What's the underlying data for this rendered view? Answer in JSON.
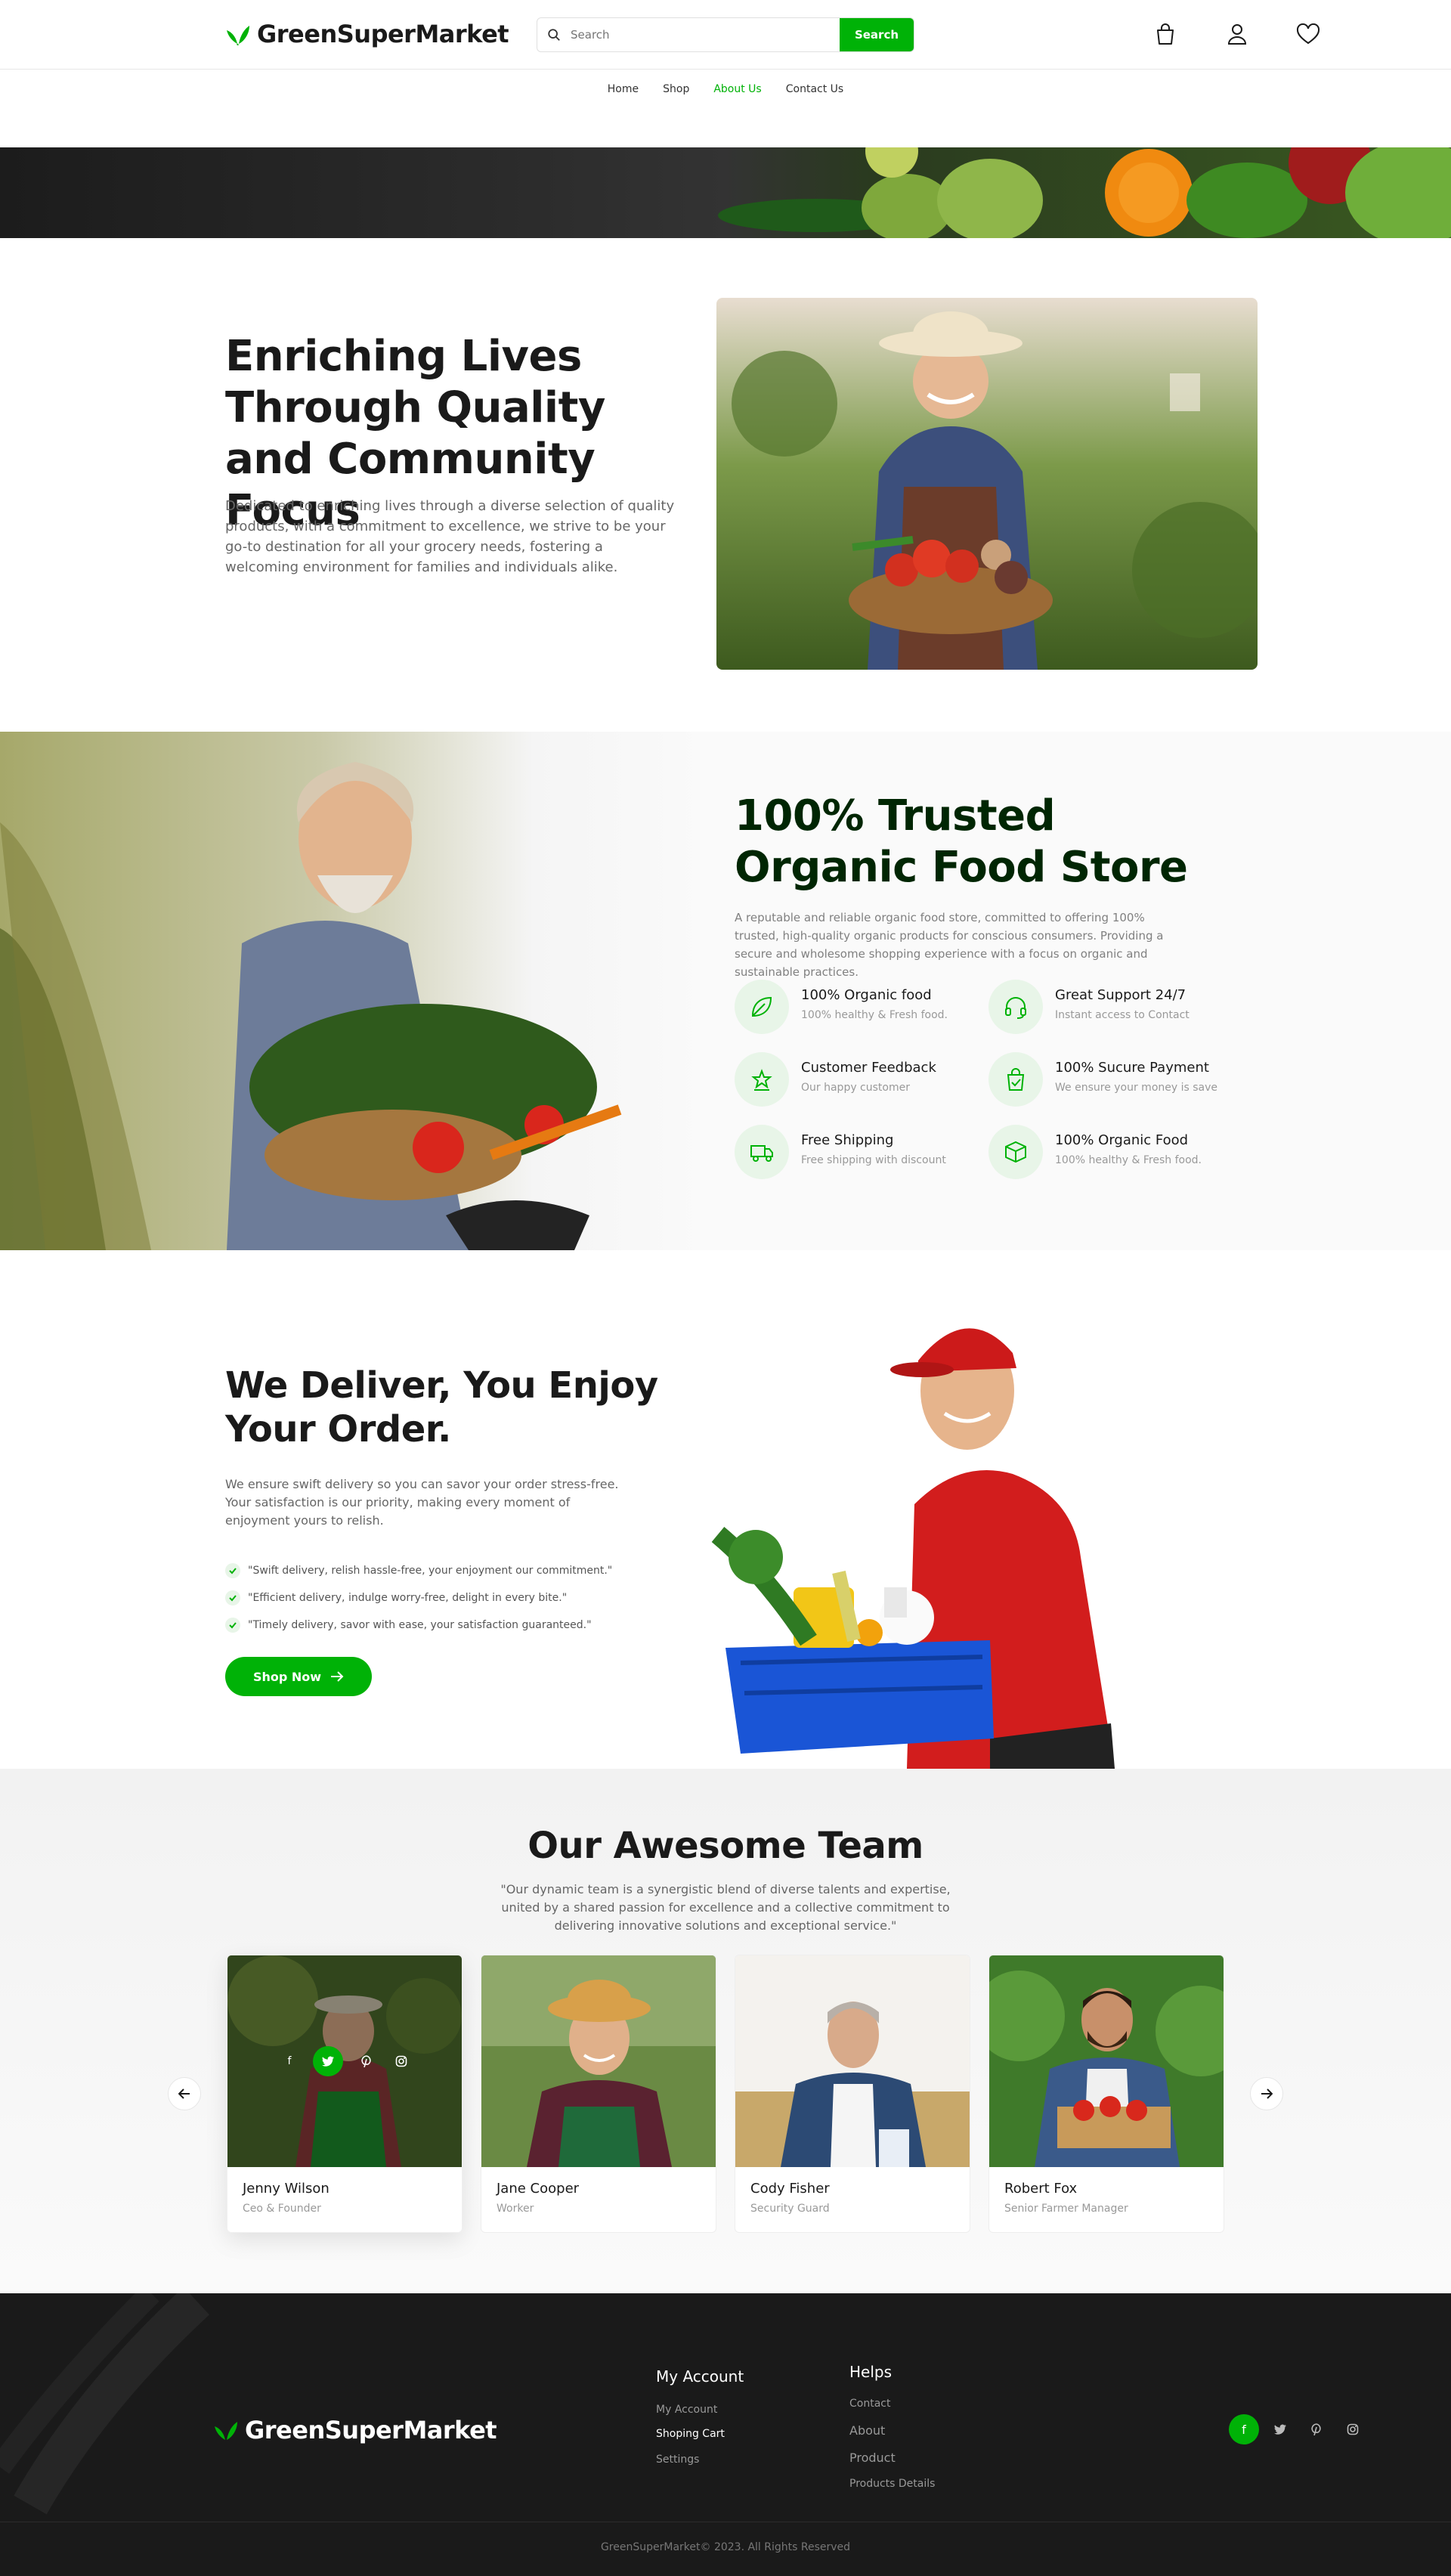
{
  "brand": {
    "name": "GreenSuperMarket",
    "accent": "#00B207",
    "dark_green": "#002603"
  },
  "header": {
    "search_placeholder": "Search",
    "search_button": "Search",
    "icons": [
      "bag-icon",
      "user-icon",
      "heart-icon"
    ]
  },
  "nav": {
    "items": [
      {
        "label": "Home"
      },
      {
        "label": "Shop"
      },
      {
        "label": "About Us",
        "active": true
      },
      {
        "label": "Contact Us"
      }
    ]
  },
  "about": {
    "title": "Enriching Lives Through Quality and Community Focus",
    "text": "Dedicated to enriching lives through a diverse selection of quality products, with a commitment to excellence, we strive to be your go-to destination for all your grocery needs, fostering a welcoming environment for families and individuals alike."
  },
  "trusted": {
    "title": "100% Trusted Organic Food Store",
    "text": "A reputable and reliable organic food store, committed to offering 100% trusted, high-quality organic products for conscious consumers. Providing a secure and wholesome shopping experience with a focus on organic and sustainable practices.",
    "features": [
      {
        "title": "100% Organic food",
        "sub": "100% healthy & Fresh food.",
        "icon": "leaf-icon"
      },
      {
        "title": "Great Support 24/7",
        "sub": "Instant access to Contact",
        "icon": "headphones-icon"
      },
      {
        "title": "Customer Feedback",
        "sub": "Our happy customer",
        "icon": "star-badge-icon"
      },
      {
        "title": "100% Sucure Payment",
        "sub": "We ensure your money is save",
        "icon": "shopping-bag-check-icon"
      },
      {
        "title": "Free Shipping",
        "sub": "Free shipping with discount",
        "icon": "truck-icon"
      },
      {
        "title": "100% Organic Food",
        "sub": "100% healthy & Fresh food.",
        "icon": "box-icon"
      }
    ]
  },
  "deliver": {
    "title": "We Deliver, You Enjoy Your Order.",
    "text": "We ensure swift delivery so you can savor your order stress-free. Your satisfaction is our priority, making every moment of enjoyment yours to relish.",
    "points": [
      "\"Swift delivery, relish hassle-free, your enjoyment our commitment.\"",
      "\"Efficient delivery, indulge worry-free, delight in every bite.\"",
      "\"Timely delivery, savor with ease, your satisfaction guaranteed.\""
    ],
    "button": "Shop Now"
  },
  "team": {
    "title": "Our Awesome Team",
    "text": "\"Our dynamic team is a synergistic blend of diverse talents and expertise, united by a shared passion for excellence and a collective commitment to delivering innovative solutions and exceptional service.\"",
    "members": [
      {
        "name": "Jenny Wilson",
        "role": "Ceo & Founder"
      },
      {
        "name": "Jane Cooper",
        "role": "Worker"
      },
      {
        "name": "Cody Fisher",
        "role": "Security Guard"
      },
      {
        "name": "Robert Fox",
        "role": "Senior Farmer Manager"
      }
    ]
  },
  "footer": {
    "my_account_title": "My Account",
    "my_account_links": [
      "My Account",
      "Shoping Cart",
      "Settings"
    ],
    "helps_title": "Helps",
    "helps_links": [
      "Contact",
      "About",
      "Product",
      "Products Details"
    ],
    "social": [
      "facebook-icon",
      "twitter-icon",
      "pinterest-icon",
      "instagram-icon"
    ],
    "copyright": "GreenSuperMarket© 2023. All Rights Reserved"
  }
}
